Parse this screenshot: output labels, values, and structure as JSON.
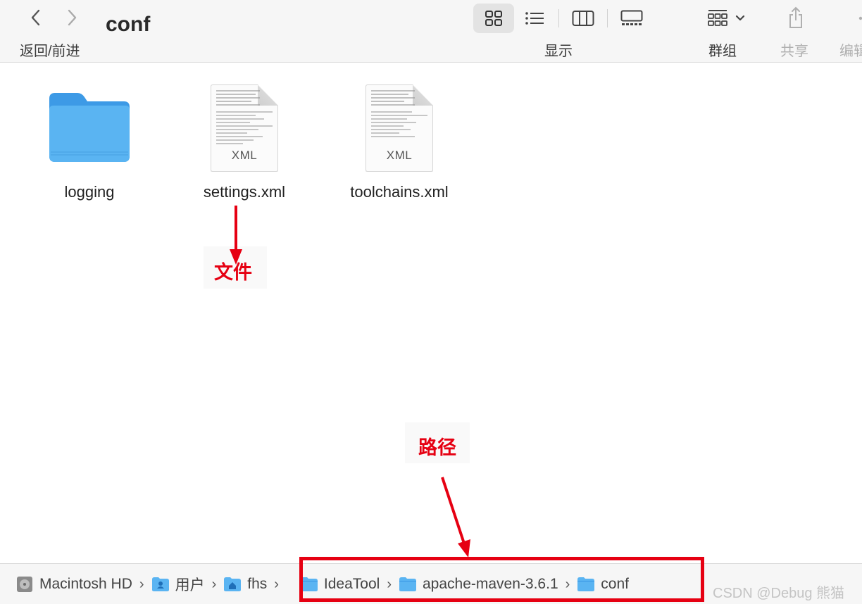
{
  "toolbar": {
    "nav_label": "返回/前进",
    "title": "conf",
    "view_label": "显示",
    "group_label": "群组",
    "share_label": "共享",
    "edit_label": "编辑"
  },
  "files": [
    {
      "name": "logging",
      "kind": "folder"
    },
    {
      "name": "settings.xml",
      "kind": "xml",
      "ext": "XML"
    },
    {
      "name": "toolchains.xml",
      "kind": "xml",
      "ext": "XML"
    }
  ],
  "annotations": {
    "file": "文件",
    "path": "路径",
    "color": "#e60012"
  },
  "pathbar": {
    "items": [
      {
        "label": "Macintosh HD",
        "icon": "hard-drive-icon"
      },
      {
        "label": "用户",
        "icon": "users-folder-icon"
      },
      {
        "label": "fhs",
        "icon": "home-folder-icon"
      },
      {
        "label": "IdeaTool",
        "icon": "folder-icon"
      },
      {
        "label": "apache-maven-3.6.1",
        "icon": "folder-icon"
      },
      {
        "label": "conf",
        "icon": "folder-icon"
      }
    ],
    "separator": "›"
  },
  "watermark": "CSDN @Debug 熊猫",
  "colors": {
    "folder_blue": "#5ab4f2",
    "accent_red": "#e60012",
    "toolbar_bg": "#f6f6f6"
  }
}
